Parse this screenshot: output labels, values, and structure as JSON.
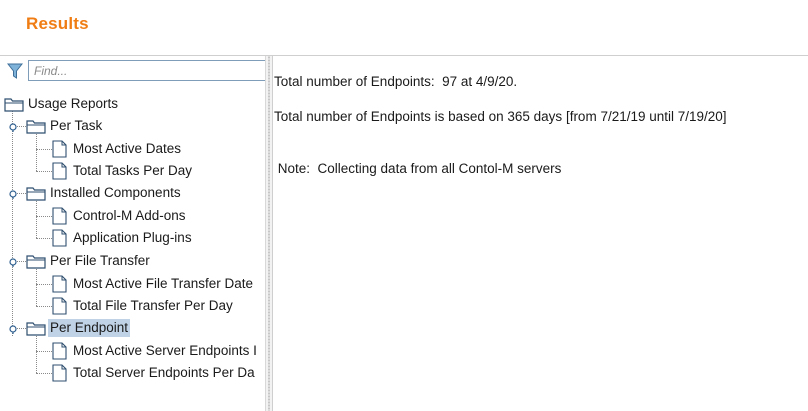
{
  "header": {
    "title": "Results"
  },
  "filter": {
    "placeholder": "Find..."
  },
  "tree": {
    "root": "Usage Reports",
    "groups": [
      {
        "label": "Per Task",
        "items": [
          "Most Active Dates",
          "Total Tasks Per Day"
        ]
      },
      {
        "label": "Installed Components",
        "items": [
          "Control-M Add-ons",
          "Application Plug-ins"
        ]
      },
      {
        "label": "Per File Transfer",
        "items": [
          "Most Active File Transfer Date",
          "Total File Transfer Per Day"
        ]
      },
      {
        "label": "Per Endpoint",
        "items": [
          "Most Active Server Endpoints I",
          "Total Server Endpoints Per Da"
        ]
      }
    ],
    "selected": "Per Endpoint"
  },
  "details": {
    "line1": "Total number of Endpoints:  97 at 4/9/20.",
    "line2": "Total number of Endpoints is based on 365 days [from 7/21/19 until 7/19/20]",
    "note": " Note:  Collecting data from all Contol-M servers"
  },
  "colors": {
    "accent": "#f07d14",
    "selection": "#bfd2e6"
  }
}
